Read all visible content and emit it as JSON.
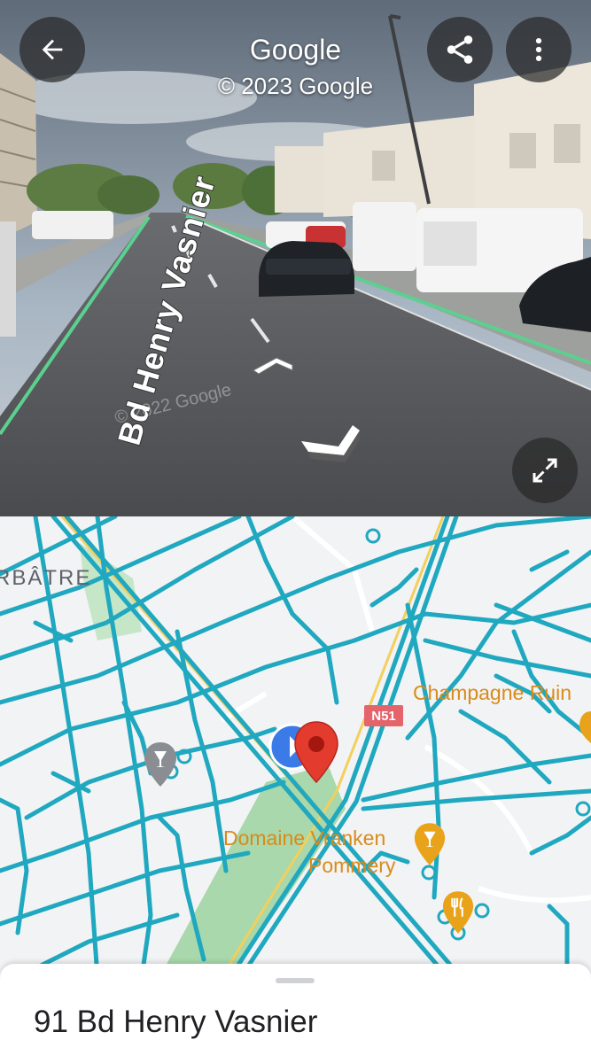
{
  "header": {
    "title": "Google",
    "copyright": "© 2023 Google"
  },
  "streetview": {
    "street_name": "Bd Henry Vasnier",
    "watermark": "© 2022 Google"
  },
  "map": {
    "labels": {
      "district": "RBÂTRE",
      "poi_champagne": "Champagne Ruin",
      "poi_domaine_line1": "Domaine Vranken",
      "poi_domaine_line2": "Pommery",
      "road_shield": "N51"
    },
    "colors": {
      "road_highlight": "#1fa8bf",
      "poi_orange": "#e8a31b",
      "pin_red": "#e33b2e",
      "pegman_blue": "#3b7be8",
      "park_green": "#c5e6c7"
    }
  },
  "bottom_sheet": {
    "address": "91 Bd Henry Vasnier"
  },
  "icons": {
    "back": "arrow-left-icon",
    "share": "share-icon",
    "more": "more-vert-icon",
    "expand": "expand-icon"
  }
}
